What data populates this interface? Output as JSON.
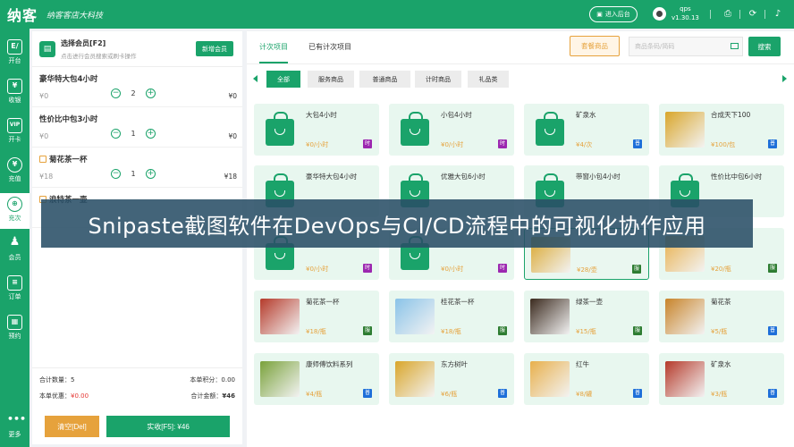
{
  "app": {
    "logo": "纳客",
    "slogan": "纳客客店大科技",
    "enter_backend": "进入后台",
    "user_name": "qps",
    "version": "v1.30.13"
  },
  "nav": [
    {
      "label": "开台",
      "icon": "E/"
    },
    {
      "label": "收银",
      "icon": "¥"
    },
    {
      "label": "开卡",
      "icon": "VIP"
    },
    {
      "label": "充值",
      "icon": "¥"
    },
    {
      "label": "充次",
      "icon": "⊕"
    },
    {
      "label": "会员",
      "icon": "♟"
    },
    {
      "label": "订单",
      "icon": "≡"
    },
    {
      "label": "预约",
      "icon": "▦"
    },
    {
      "label": "更多",
      "icon": "•••"
    }
  ],
  "member": {
    "title": "选择会员[F2]",
    "subtitle": "点击进行会员搜索或刷卡操作",
    "new_button": "新增会员"
  },
  "cart": [
    {
      "name": "豪华特大包4小时",
      "price": "¥0",
      "qty": "2",
      "subtotal": "¥0",
      "marked": false
    },
    {
      "name": "性价比中包3小时",
      "price": "¥0",
      "qty": "1",
      "subtotal": "¥0",
      "marked": false
    },
    {
      "name": "菊花茶一杯",
      "price": "¥18",
      "qty": "1",
      "subtotal": "¥18",
      "marked": true
    },
    {
      "name": "浪特茶一壶",
      "price": "",
      "qty": "",
      "subtotal": "",
      "marked": true
    }
  ],
  "summary": {
    "qty_label": "合计数量：",
    "qty_value": "5",
    "points_label": "本单积分：",
    "points_value": "0.00",
    "discount_label": "本单优惠：",
    "discount_value": "¥0.00",
    "total_label": "合计金额：",
    "total_value": "¥46"
  },
  "actions": {
    "clear": "清空[Del]",
    "pay": "实收[F5]: ¥46"
  },
  "tabs": [
    "计次项目",
    "已有计次项目"
  ],
  "set_goods": "套餐商品",
  "search_placeholder": "商品条码/简码",
  "search_button": "搜索",
  "categories": [
    "全部",
    "服务商品",
    "普通商品",
    "计时商品",
    "礼品类"
  ],
  "products": [
    {
      "name": "大包4小时",
      "price": "¥0/小时",
      "tag": "时",
      "img": "bag"
    },
    {
      "name": "小包4小时",
      "price": "¥0/小时",
      "tag": "时",
      "img": "bag"
    },
    {
      "name": "矿泉水",
      "price": "¥4/次",
      "tag": "普",
      "img": "bag"
    },
    {
      "name": "合成天下100",
      "price": "¥100/包",
      "tag": "普",
      "img": "photo"
    },
    {
      "name": "豪华特大包4小时",
      "price": "",
      "tag": "",
      "img": "bag"
    },
    {
      "name": "优雅大包6小时",
      "price": "",
      "tag": "",
      "img": "bag"
    },
    {
      "name": "带窗小包4小时",
      "price": "",
      "tag": "",
      "img": "bag"
    },
    {
      "name": "性价比中包6小时",
      "price": "",
      "tag": "",
      "img": "bag"
    },
    {
      "name": "",
      "price": "¥0/小时",
      "tag": "时",
      "img": "bag"
    },
    {
      "name": "",
      "price": "¥0/小时",
      "tag": "时",
      "img": "bag"
    },
    {
      "name": "",
      "price": "¥28/壶",
      "tag": "服",
      "img": "photo"
    },
    {
      "name": "",
      "price": "¥20/瓶",
      "tag": "服",
      "img": "photo"
    },
    {
      "name": "菊花茶一杯",
      "price": "¥18/瓶",
      "tag": "服",
      "img": "photo"
    },
    {
      "name": "桂花茶一杯",
      "price": "¥18/瓶",
      "tag": "服",
      "img": "photo"
    },
    {
      "name": "绿茶一壶",
      "price": "¥15/瓶",
      "tag": "服",
      "img": "photo"
    },
    {
      "name": "菊花茶",
      "price": "¥5/瓶",
      "tag": "普",
      "img": "photo"
    },
    {
      "name": "康师傅饮料系列",
      "price": "¥4/瓶",
      "tag": "普",
      "img": "photo"
    },
    {
      "name": "东方树叶",
      "price": "¥6/瓶",
      "tag": "普",
      "img": "photo"
    },
    {
      "name": "红牛",
      "price": "¥8/罐",
      "tag": "普",
      "img": "photo"
    },
    {
      "name": "矿泉水",
      "price": "¥3/瓶",
      "tag": "普",
      "img": "photo"
    }
  ],
  "banner": "Snipaste截图软件在DevOps与CI/CD流程中的可视化协作应用",
  "colors": {
    "primary": "#1aa36a",
    "orange": "#e6a23c",
    "purple": "#9c27b0",
    "blue": "#1e6fd9",
    "green_tag": "#2e7d32"
  }
}
